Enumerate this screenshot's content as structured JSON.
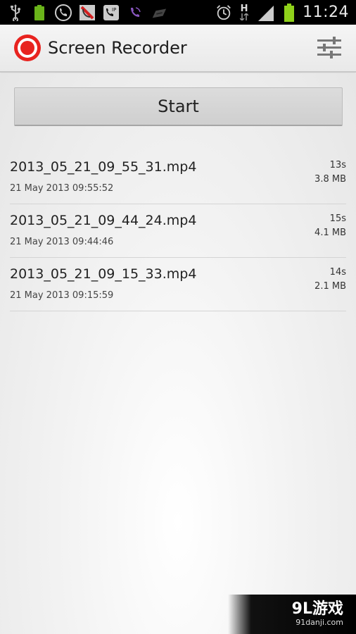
{
  "status_bar": {
    "time": "11:24",
    "battery_small_text": "100%",
    "network_label": "H",
    "icons_left": [
      "usb-icon",
      "battery-full-icon",
      "phone-call-icon",
      "missed-call-icon",
      "voip-icon",
      "viber-icon",
      "swipe-icon"
    ],
    "icons_right": [
      "alarm-icon",
      "network-h-icon",
      "signal-icon",
      "battery-icon"
    ]
  },
  "action_bar": {
    "title": "Screen Recorder",
    "app_icon": "record-icon",
    "settings_icon": "sliders-icon"
  },
  "main": {
    "start_label": "Start"
  },
  "files": [
    {
      "name": "2013_05_21_09_55_31.mp4",
      "date": "21 May 2013 09:55:52",
      "duration": "13s",
      "size": "3.8 MB"
    },
    {
      "name": "2013_05_21_09_44_24.mp4",
      "date": "21 May 2013 09:44:46",
      "duration": "15s",
      "size": "4.1 MB"
    },
    {
      "name": "2013_05_21_09_15_33.mp4",
      "date": "21 May 2013 09:15:59",
      "duration": "14s",
      "size": "2.1 MB"
    }
  ],
  "watermark": {
    "logo": "9L游戏",
    "url": "91danji.com"
  },
  "colors": {
    "record_red": "#e8231f",
    "battery_green": "#8fd11a",
    "status_bar_bg": "#000000"
  }
}
